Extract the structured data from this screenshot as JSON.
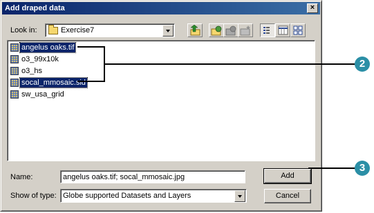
{
  "dialog": {
    "title": "Add draped data",
    "close_glyph": "×"
  },
  "lookin": {
    "label": "Look in:",
    "value": "Exercise7",
    "toolbar_icons": [
      "up-one-level-icon",
      "connect-to-folder-icon",
      "disconnect-folder-icon",
      "new-folder-icon",
      "list-view-icon",
      "details-view-icon",
      "thumbnails-view-icon"
    ]
  },
  "files": [
    {
      "name": "angelus oaks.tif",
      "selected": true
    },
    {
      "name": "o3_99x10k",
      "selected": false
    },
    {
      "name": "o3_hs",
      "selected": false
    },
    {
      "name": "socal_mmosaic.sid",
      "selected": true
    },
    {
      "name": "sw_usa_grid",
      "selected": false
    }
  ],
  "name_field": {
    "label": "Name:",
    "value": "angelus oaks.tif; socal_mmosaic.jpg"
  },
  "type_field": {
    "label": "Show of type:",
    "value": "Globe supported Datasets and Layers"
  },
  "buttons": {
    "add": "Add",
    "cancel": "Cancel"
  },
  "callouts": {
    "step2": "2",
    "step3": "3",
    "color": "#2b8fa6"
  }
}
